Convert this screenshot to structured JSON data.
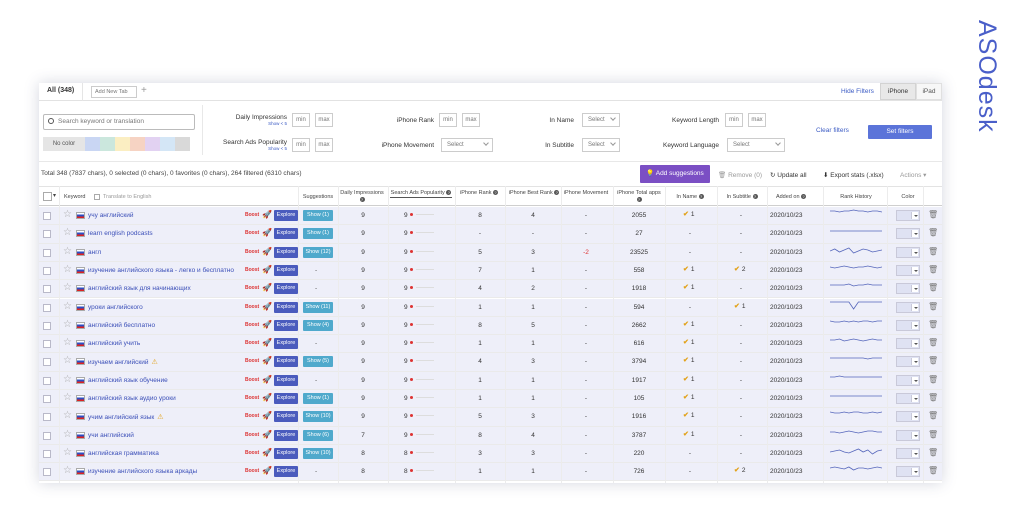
{
  "brand": {
    "logo_text": "ASOdesk",
    "color": "#4a5fc9"
  },
  "tabs": {
    "all": "All (348)",
    "new_tab_placeholder": "Add New Tab",
    "plus": "+",
    "hide_filters": "Hide Filters",
    "iphone": "iPhone",
    "ipad": "iPad"
  },
  "filters": {
    "search_placeholder": "Search keyword or translation",
    "no_color": "No color",
    "swatches": [
      "#c9d6f3",
      "#cbe7dd",
      "#fbeec2",
      "#f6d3c3",
      "#e2d2f2",
      "#d4e6f6",
      "#d9d9d9"
    ],
    "daily_impressions": "Daily Impressions",
    "daily_impressions_sub": "Show < 5",
    "search_ads_popularity": "Search Ads Popularity",
    "search_ads_popularity_sub": "Show < 5",
    "iphone_rank": "iPhone Rank",
    "iphone_movement": "iPhone Movement",
    "in_name": "In Name",
    "in_subtitle": "In Subtitle",
    "keyword_length": "Keyword Length",
    "keyword_language": "Keyword Language",
    "min": "min",
    "max": "max",
    "select": "Select",
    "clear": "Clear filters",
    "set": "Set filters"
  },
  "actions": {
    "total": "Total 348 (7837 chars), 0 selected (0 chars), 0 favorites (0 chars), 264 filtered (6310 chars)",
    "add_suggestions": "Add suggestions",
    "remove": "Remove (0)",
    "update_all": "Update all",
    "export": "Export stats (.xlsx)",
    "actions": "Actions"
  },
  "columns": {
    "keyword": "Keyword",
    "translate": "Translate to English",
    "suggestions": "Suggestions",
    "daily_impressions": "Daily Impressions",
    "search_ads_popularity": "Search Ads Popularity",
    "iphone_rank": "iPhone Rank",
    "iphone_best_rank": "iPhone Best Rank",
    "iphone_movement": "iPhone Movement",
    "iphone_total_apps": "iPhone Total apps",
    "in_name": "In Name",
    "in_subtitle": "In Subtitle",
    "added_on": "Added on",
    "rank_history": "Rank History",
    "color": "Color"
  },
  "row_labels": {
    "boost": "Boost",
    "explore": "Explore",
    "dash": "-"
  },
  "rows": [
    {
      "keyword": "учу английский",
      "warn": false,
      "show": "Show (1)",
      "daily": "9",
      "pop": "9",
      "rank": "8",
      "best": "4",
      "move": "-",
      "total": "2055",
      "in_name": "1",
      "in_sub": "-",
      "added": "2020/10/23"
    },
    {
      "keyword": "learn english podcasts",
      "warn": false,
      "show": "Show (1)",
      "daily": "9",
      "pop": "9",
      "rank": "-",
      "best": "-",
      "move": "-",
      "total": "27",
      "in_name": "-",
      "in_sub": "-",
      "added": "2020/10/23"
    },
    {
      "keyword": "англ",
      "warn": false,
      "show": "Show (12)",
      "daily": "9",
      "pop": "9",
      "rank": "5",
      "best": "3",
      "move": "-2",
      "total": "23525",
      "in_name": "-",
      "in_sub": "-",
      "added": "2020/10/23"
    },
    {
      "keyword": "изучение английского языка - легко и бесплатно",
      "warn": false,
      "show": "-",
      "daily": "9",
      "pop": "9",
      "rank": "7",
      "best": "1",
      "move": "-",
      "total": "558",
      "in_name": "1",
      "in_sub": "2",
      "added": "2020/10/23"
    },
    {
      "keyword": "английский язык для начинающих",
      "warn": false,
      "show": "-",
      "daily": "9",
      "pop": "9",
      "rank": "4",
      "best": "2",
      "move": "-",
      "total": "1918",
      "in_name": "1",
      "in_sub": "-",
      "added": "2020/10/23"
    },
    {
      "keyword": "уроки английского",
      "warn": false,
      "show": "Show (11)",
      "daily": "9",
      "pop": "9",
      "rank": "1",
      "best": "1",
      "move": "-",
      "total": "594",
      "in_name": "-",
      "in_sub": "1",
      "added": "2020/10/23"
    },
    {
      "keyword": "английский бесплатно",
      "warn": false,
      "show": "Show (4)",
      "daily": "9",
      "pop": "9",
      "rank": "8",
      "best": "5",
      "move": "-",
      "total": "2662",
      "in_name": "1",
      "in_sub": "-",
      "added": "2020/10/23"
    },
    {
      "keyword": "английский учить",
      "warn": false,
      "show": "-",
      "daily": "9",
      "pop": "9",
      "rank": "1",
      "best": "1",
      "move": "-",
      "total": "616",
      "in_name": "1",
      "in_sub": "-",
      "added": "2020/10/23"
    },
    {
      "keyword": "изучаем английский",
      "warn": true,
      "show": "Show (5)",
      "daily": "9",
      "pop": "9",
      "rank": "4",
      "best": "3",
      "move": "-",
      "total": "3794",
      "in_name": "1",
      "in_sub": "-",
      "added": "2020/10/23"
    },
    {
      "keyword": "английский язык обучение",
      "warn": false,
      "show": "-",
      "daily": "9",
      "pop": "9",
      "rank": "1",
      "best": "1",
      "move": "-",
      "total": "1917",
      "in_name": "1",
      "in_sub": "-",
      "added": "2020/10/23"
    },
    {
      "keyword": "английский язык аудио уроки",
      "warn": false,
      "show": "Show (1)",
      "daily": "9",
      "pop": "9",
      "rank": "1",
      "best": "1",
      "move": "-",
      "total": "105",
      "in_name": "1",
      "in_sub": "-",
      "added": "2020/10/23"
    },
    {
      "keyword": "учим английский язык",
      "warn": true,
      "show": "Show (10)",
      "daily": "9",
      "pop": "9",
      "rank": "5",
      "best": "3",
      "move": "-",
      "total": "1916",
      "in_name": "1",
      "in_sub": "-",
      "added": "2020/10/23"
    },
    {
      "keyword": "учи английский",
      "warn": false,
      "show": "Show (6)",
      "daily": "7",
      "pop": "9",
      "rank": "8",
      "best": "4",
      "move": "-",
      "total": "3787",
      "in_name": "1",
      "in_sub": "-",
      "added": "2020/10/23"
    },
    {
      "keyword": "английская грамматика",
      "warn": false,
      "show": "Show (10)",
      "daily": "8",
      "pop": "8",
      "rank": "3",
      "best": "3",
      "move": "-",
      "total": "220",
      "in_name": "-",
      "in_sub": "-",
      "added": "2020/10/23"
    },
    {
      "keyword": "изучение английского языка аркады",
      "warn": false,
      "show": "-",
      "daily": "8",
      "pop": "8",
      "rank": "1",
      "best": "1",
      "move": "-",
      "total": "726",
      "in_name": "-",
      "in_sub": "2",
      "added": "2020/10/23"
    }
  ],
  "colors": {
    "row_bg": "#eeeff9",
    "explore": "#4a5bbd",
    "show": "#4fa9cc",
    "add_suggestions": "#7b4fc4",
    "set_filters": "#5b74d9",
    "check": "#e2a21b",
    "red": "#d33333"
  }
}
